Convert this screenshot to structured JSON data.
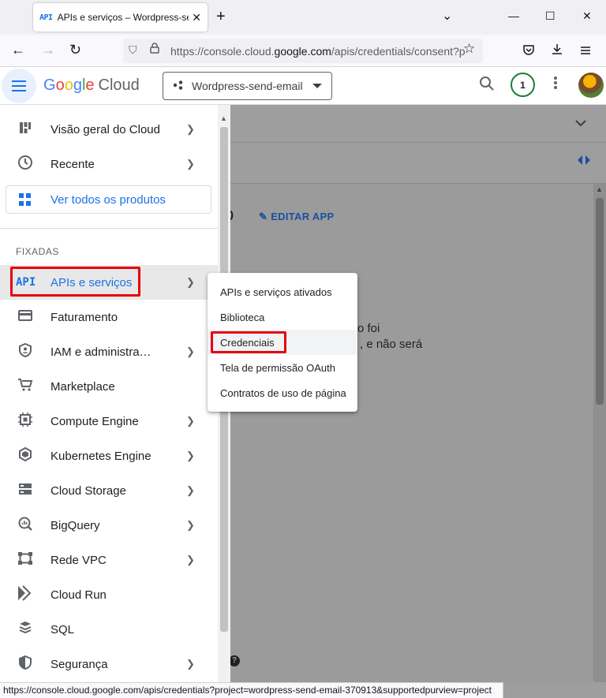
{
  "browser": {
    "tab": {
      "favicon_text": "API",
      "title": "APIs e serviços – Wordpress-send-email",
      "close": "✕"
    },
    "new_tab": "+",
    "window_controls": {
      "list": "⌄",
      "minimize": "—",
      "maximize": "☐",
      "close": "✕"
    },
    "nav": {
      "back": "←",
      "forward": "→",
      "reload": "↻"
    },
    "url": {
      "prefix": "https://console.cloud.",
      "domain": "google.com",
      "path": "/apis/credentials/consent?p"
    },
    "toolbar_icons": [
      "pocket-icon",
      "download-icon",
      "menu-icon"
    ],
    "status_url": "https://console.cloud.google.com/apis/credentials?project=wordpress-send-email-370913&supportedpurview=project"
  },
  "header": {
    "logo_google": [
      "G",
      "o",
      "o",
      "g",
      "l",
      "e"
    ],
    "logo_cloud": "Cloud",
    "project_name": "Wordpress-send-email",
    "notification_count": "1"
  },
  "drawer": {
    "top_items": [
      {
        "label": "Visão geral do Cloud",
        "icon": "dashboard-icon",
        "has_submenu": true
      },
      {
        "label": "Recente",
        "icon": "clock-icon",
        "has_submenu": true
      }
    ],
    "all_products_label": "Ver todos os produtos",
    "pinned_heading": "FIXADAS",
    "pinned_items": [
      {
        "label": "APIs e serviços",
        "icon": "api-icon",
        "icon_text": "API",
        "has_submenu": true,
        "active": true
      },
      {
        "label": "Faturamento",
        "icon": "billing-icon",
        "has_submenu": false
      },
      {
        "label": "IAM e administra…",
        "icon": "shield-person-icon",
        "has_submenu": true
      },
      {
        "label": "Marketplace",
        "icon": "cart-icon",
        "has_submenu": false
      },
      {
        "label": "Compute Engine",
        "icon": "chip-icon",
        "has_submenu": true
      },
      {
        "label": "Kubernetes Engine",
        "icon": "kubernetes-icon",
        "has_submenu": true
      },
      {
        "label": "Cloud Storage",
        "icon": "storage-icon",
        "has_submenu": true
      },
      {
        "label": "BigQuery",
        "icon": "bigquery-icon",
        "has_submenu": true
      },
      {
        "label": "Rede VPC",
        "icon": "vpc-icon",
        "has_submenu": true
      },
      {
        "label": "Cloud Run",
        "icon": "cloud-run-icon",
        "has_submenu": false
      },
      {
        "label": "SQL",
        "icon": "sql-icon",
        "has_submenu": false
      },
      {
        "label": "Segurança",
        "icon": "security-icon",
        "has_submenu": true
      }
    ]
  },
  "submenu": {
    "items": [
      {
        "label": "APIs e serviços ativados"
      },
      {
        "label": "Biblioteca"
      },
      {
        "label": "Credenciais",
        "highlighted": true
      },
      {
        "label": "Tela de permissão OAuth"
      },
      {
        "label": "Contratos de uso de página"
      }
    ]
  },
  "background": {
    "app_title_tail": "p",
    "edit_app_label": "EDITAR APP",
    "text_line1": "o foi",
    "text_line2": ", e não será"
  },
  "colors": {
    "accent": "#1a73e8",
    "highlight_box": "#e8000e",
    "badge_ring": "#188038",
    "dim_overlay": "#9e9e9e"
  }
}
